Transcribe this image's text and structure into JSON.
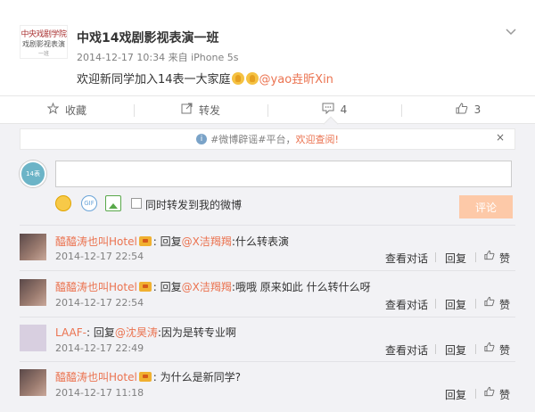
{
  "post": {
    "logo_text": [
      "中央戏剧学院",
      "戏剧影视表演",
      "一班"
    ],
    "author": "中戏14戏剧影视表演一班",
    "meta": "2014-12-17 10:34 来自 iPhone 5s",
    "text": "欢迎新同学加入14表一大家庭",
    "mention": "@yao垚昕Xin",
    "emoji": "clap-icon",
    "menu_icon": "chevron-down-icon"
  },
  "actions": {
    "favorite": {
      "label": "收藏",
      "icon": "star-icon"
    },
    "repost": {
      "label": "转发",
      "icon": "repost-icon"
    },
    "comment": {
      "label": "4",
      "icon": "comment-icon"
    },
    "like": {
      "label": "3",
      "icon": "thumbs-up-icon"
    }
  },
  "notice": {
    "prefix": "#微博辟谣#平台，",
    "highlight": "欢迎查阅!",
    "close": "×"
  },
  "composer": {
    "avatar_text": "14表",
    "input_value": "",
    "repost_checkbox_label": "同时转发到我的微博",
    "submit_label": "评论",
    "gif_label": "GIF"
  },
  "comments": [
    {
      "user": "醯醯涛也叫Hotel",
      "reply_word": "回复",
      "mention": "@X洁羯羯",
      "text": ":什么转表演",
      "time": "2014-12-17 22:54",
      "actions": [
        "查看对话",
        "回复",
        "赞"
      ]
    },
    {
      "user": "醯醯涛也叫Hotel",
      "reply_word": "回复",
      "mention": "@X洁羯羯",
      "text": ":哦哦 原来如此 什么转什么呀",
      "time": "2014-12-17 22:54",
      "actions": [
        "查看对话",
        "回复",
        "赞"
      ]
    },
    {
      "user": "LAAF-",
      "reply_word": "回复",
      "mention": "@沈昊涛",
      "text": ":因为是转专业啊",
      "time": "2014-12-17 22:49",
      "actions": [
        "查看对话",
        "回复",
        "赞"
      ]
    },
    {
      "user": "醯醯涛也叫Hotel",
      "reply_word": "",
      "mention": "",
      "text": "为什么是新同学?",
      "time": "2014-12-17 11:18",
      "actions": [
        "回复",
        "赞"
      ]
    }
  ],
  "colors": {
    "accent": "#eb7350",
    "submit_bg": "#fdc9a8",
    "panel_bg": "#f2f2f5"
  }
}
